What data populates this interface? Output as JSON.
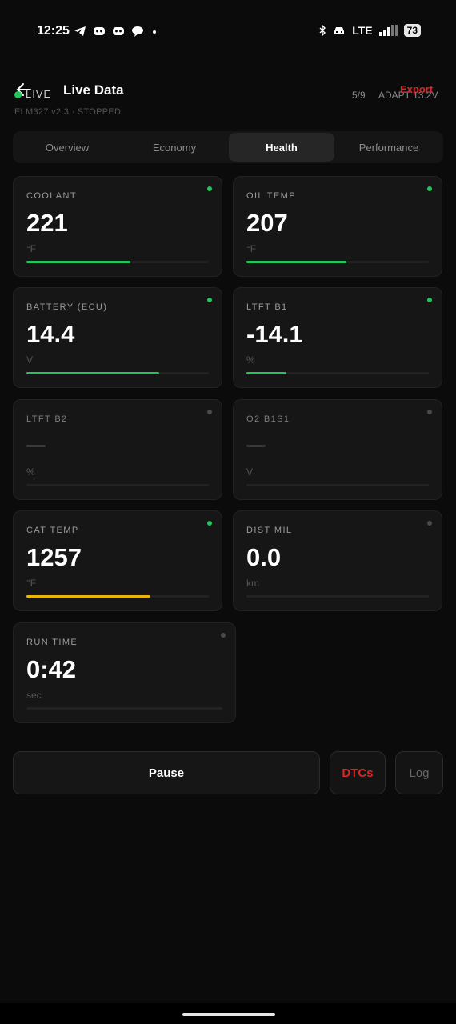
{
  "status_bar": {
    "time": "12:25",
    "network": "LTE",
    "battery": "73",
    "left_icons": [
      "telegram-icon",
      "discord-icon",
      "discord-icon",
      "chat-icon",
      "dot-icon"
    ],
    "right_icons": [
      "bluetooth-icon",
      "car-icon",
      "signal-icon",
      "battery-icon"
    ]
  },
  "header": {
    "live_label": "LIVE",
    "title": "Live Data",
    "subtitle": "ELM327 v2.3 · STOPPED",
    "count": "5/9",
    "adapter_voltage": "ADAPT 13.2V",
    "export_label": "Export",
    "live_color": "#22c55e"
  },
  "tabs": [
    {
      "label": "Overview",
      "active": false
    },
    {
      "label": "Economy",
      "active": false
    },
    {
      "label": "Health",
      "active": true
    },
    {
      "label": "Performance",
      "active": false
    }
  ],
  "cards": [
    {
      "label": "COOLANT",
      "value": "221",
      "unit": "°F",
      "active": true,
      "fill": 0.57,
      "color": "#22c55e"
    },
    {
      "label": "OIL TEMP",
      "value": "207",
      "unit": "°F",
      "active": true,
      "fill": 0.55,
      "color": "#22c55e"
    },
    {
      "label": "BATTERY (ECU)",
      "value": "14.4",
      "unit": "V",
      "active": true,
      "fill": 0.73,
      "color": "#22c55e"
    },
    {
      "label": "LTFT B1",
      "value": "-14.1",
      "unit": "%",
      "active": true,
      "fill": 0.22,
      "color": "#22c55e"
    },
    {
      "label": "LTFT B2",
      "value": "",
      "unit": "%",
      "active": false,
      "fill": 0,
      "color": "#22c55e"
    },
    {
      "label": "O2 B1S1",
      "value": "",
      "unit": "V",
      "active": false,
      "fill": 0,
      "color": "#22c55e"
    },
    {
      "label": "CAT TEMP",
      "value": "1257",
      "unit": "°F",
      "active": true,
      "fill": 0.68,
      "color": "#eab308"
    },
    {
      "label": "DIST MIL",
      "value": "0.0",
      "unit": "km",
      "active": false,
      "fill": 0,
      "color": "#22c55e"
    },
    {
      "label": "RUN TIME",
      "value": "0:42",
      "unit": "sec",
      "active": false,
      "fill": 0,
      "color": "#22c55e"
    }
  ],
  "buttons": {
    "pause": "Pause",
    "dtcs": "DTCs",
    "log": "Log",
    "dtcs_color": "#dc2626"
  }
}
